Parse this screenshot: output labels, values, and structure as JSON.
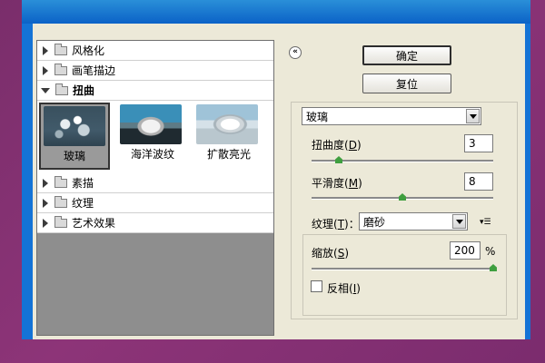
{
  "gallery": {
    "categories_top": [
      {
        "label": "风格化",
        "expanded": false
      },
      {
        "label": "画笔描边",
        "expanded": false
      },
      {
        "label": "扭曲",
        "expanded": true
      }
    ],
    "thumbnails": [
      {
        "label": "玻璃",
        "selected": true
      },
      {
        "label": "海洋波纹",
        "selected": false
      },
      {
        "label": "扩散亮光",
        "selected": false
      }
    ],
    "categories_bottom": [
      {
        "label": "素描",
        "expanded": false
      },
      {
        "label": "纹理",
        "expanded": false
      },
      {
        "label": "艺术效果",
        "expanded": false
      }
    ]
  },
  "buttons": {
    "ok": "确定",
    "reset": "复位",
    "collapse_icon": "«"
  },
  "filter": {
    "selected": "玻璃",
    "distortion": {
      "label": "扭曲度",
      "hotkey": "D",
      "value": "3",
      "slider_fraction": 0.15
    },
    "smoothness": {
      "label": "平滑度",
      "hotkey": "M",
      "value": "8",
      "slider_fraction": 0.5
    },
    "texture": {
      "label": "纹理",
      "hotkey": "T",
      "value": "磨砂"
    },
    "scaling": {
      "label": "缩放",
      "hotkey": "S",
      "value": "200",
      "unit": "%",
      "slider_fraction": 1.0
    },
    "invert": {
      "label": "反相",
      "hotkey": "I",
      "checked": false
    }
  },
  "colors": {
    "slider_thumb": "#3f9f3f",
    "window_border": "#1473d6",
    "background": "#8d3478"
  }
}
